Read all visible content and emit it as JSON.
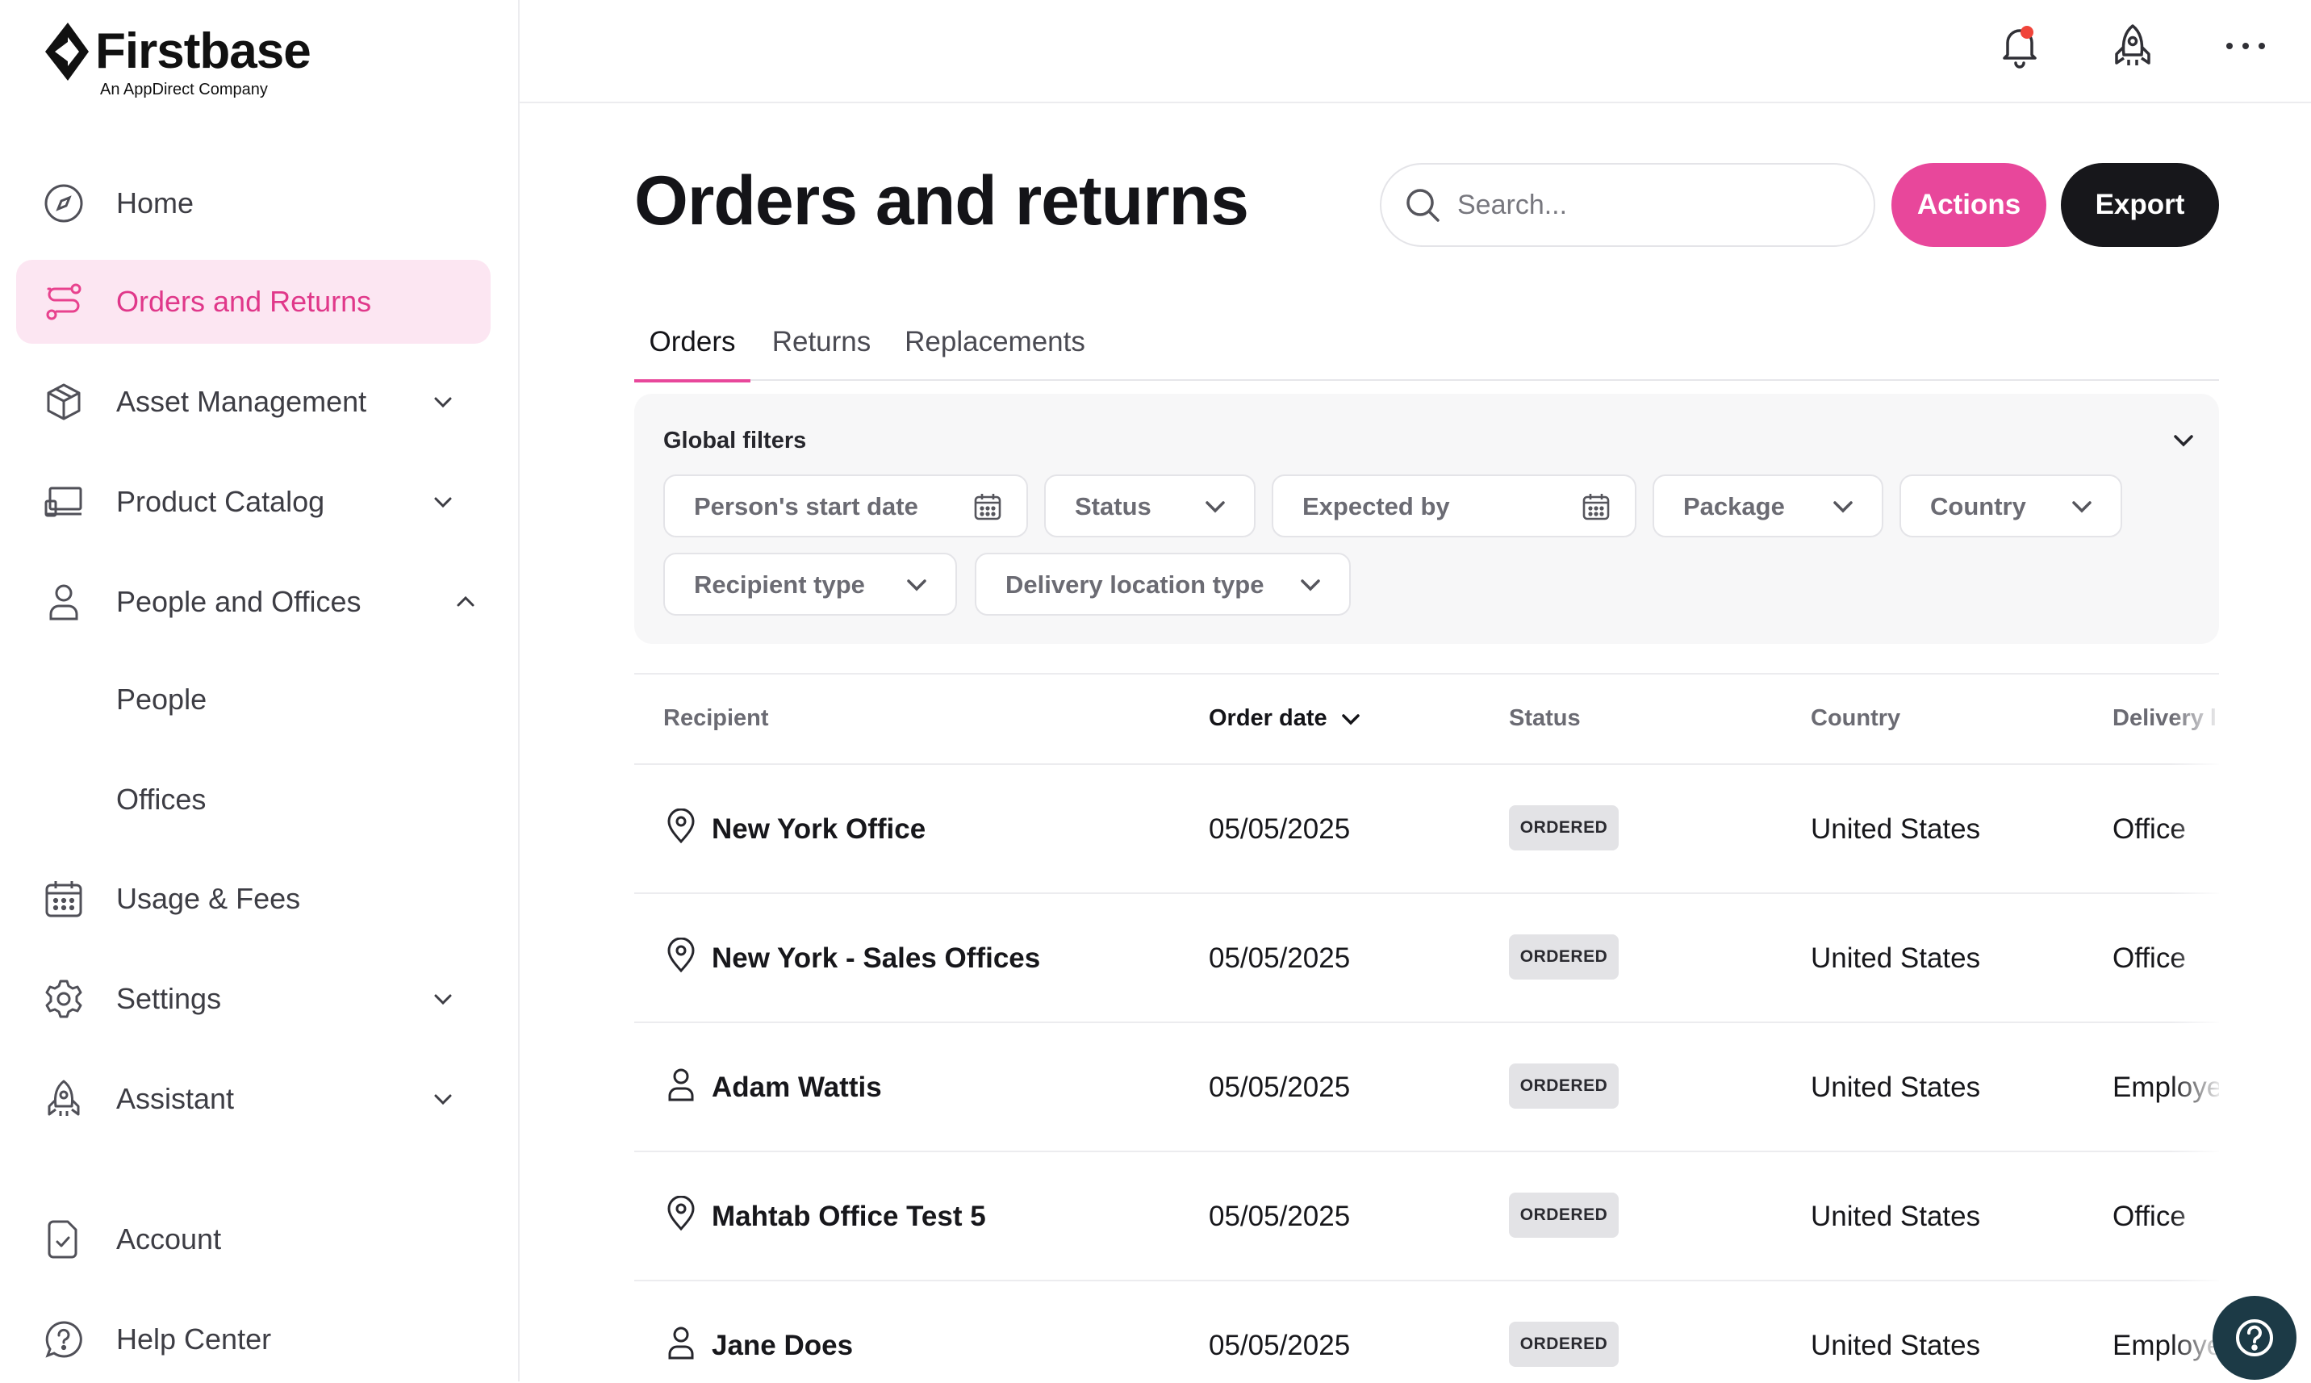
{
  "brand": {
    "name": "Firstbase",
    "tagline": "An AppDirect Company"
  },
  "sidebar": {
    "items": [
      {
        "label": "Home",
        "icon": "compass-icon"
      },
      {
        "label": "Orders and Returns",
        "icon": "route-icon",
        "active": true
      },
      {
        "label": "Asset Management",
        "icon": "box-icon",
        "expandable": true
      },
      {
        "label": "Product Catalog",
        "icon": "laptop-icon",
        "expandable": true
      },
      {
        "label": "People and Offices",
        "icon": "person-icon",
        "expanded": true
      },
      {
        "label": "Usage & Fees",
        "icon": "calendar-icon"
      },
      {
        "label": "Settings",
        "icon": "gear-icon",
        "expandable": true
      },
      {
        "label": "Assistant",
        "icon": "rocket-icon",
        "expandable": true
      },
      {
        "label": "Account",
        "icon": "document-check-icon"
      },
      {
        "label": "Help Center",
        "icon": "help-bubble-icon"
      }
    ],
    "subitems": [
      "People",
      "Offices"
    ]
  },
  "topbar": {
    "icons": [
      "bell-icon",
      "rocket-icon",
      "more-icon"
    ],
    "has_notification": true
  },
  "page": {
    "title": "Orders and returns"
  },
  "search": {
    "placeholder": "Search..."
  },
  "buttons": {
    "actions": "Actions",
    "export": "Export"
  },
  "colors": {
    "accent": "#e8479b",
    "active_bg": "#fce6f2",
    "dark": "#17171b"
  },
  "tabs": [
    {
      "label": "Orders",
      "active": true
    },
    {
      "label": "Returns"
    },
    {
      "label": "Replacements"
    }
  ],
  "filters": {
    "title": "Global filters",
    "items": [
      {
        "label": "Person's start date",
        "type": "date"
      },
      {
        "label": "Status",
        "type": "select"
      },
      {
        "label": "Expected by",
        "type": "date"
      },
      {
        "label": "Package",
        "type": "select"
      },
      {
        "label": "Country",
        "type": "select"
      },
      {
        "label": "Recipient type",
        "type": "select"
      },
      {
        "label": "Delivery location type",
        "type": "select"
      }
    ]
  },
  "table": {
    "columns": [
      "Recipient",
      "Order date",
      "Status",
      "Country",
      "Delivery l"
    ],
    "sorted_column": "Order date",
    "rows": [
      {
        "icon": "location-pin-icon",
        "recipient": "New York Office",
        "order_date": "05/05/2025",
        "status": "ORDERED",
        "country": "United States",
        "delivery": "Office"
      },
      {
        "icon": "location-pin-icon",
        "recipient": "New York - Sales Offices",
        "order_date": "05/05/2025",
        "status": "ORDERED",
        "country": "United States",
        "delivery": "Office"
      },
      {
        "icon": "person-icon",
        "recipient": "Adam Wattis",
        "order_date": "05/05/2025",
        "status": "ORDERED",
        "country": "United States",
        "delivery": "Employe"
      },
      {
        "icon": "location-pin-icon",
        "recipient": "Mahtab Office Test 5",
        "order_date": "05/05/2025",
        "status": "ORDERED",
        "country": "United States",
        "delivery": "Office"
      },
      {
        "icon": "person-icon",
        "recipient": "Jane Does",
        "order_date": "05/05/2025",
        "status": "ORDERED",
        "country": "United States",
        "delivery": "Employe"
      }
    ]
  },
  "help_button": {
    "icon": "question-icon"
  }
}
